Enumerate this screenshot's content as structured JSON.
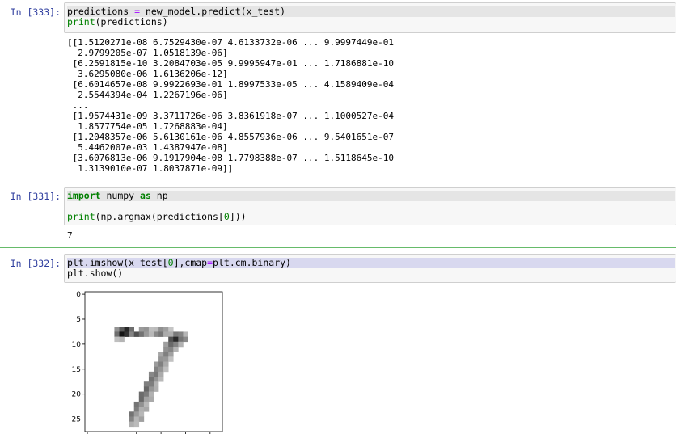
{
  "cells": [
    {
      "prompt": "In [333]:",
      "code_lines": [
        {
          "a": "predictions",
          "op": " = ",
          "b": "new_model.predict(x_test)"
        },
        {
          "fn": "print",
          "b": "(predictions)"
        }
      ],
      "output_lines": [
        "[[1.5120271e-08 6.7529430e-07 4.6133732e-06 ... 9.9997449e-01",
        "  2.9799205e-07 1.0518139e-06]",
        " [6.2591815e-10 3.2084703e-05 9.9995947e-01 ... 1.7186881e-10",
        "  3.6295080e-06 1.6136206e-12]",
        " [6.6014657e-08 9.9922693e-01 1.8997533e-05 ... 4.1589409e-04",
        "  2.5544394e-04 1.2267196e-06]",
        " ...",
        " [1.9574431e-09 3.3711726e-06 3.8361918e-07 ... 1.1000527e-04",
        "  1.8577754e-05 1.7268883e-04]",
        " [1.2048357e-06 5.6130161e-06 4.8557936e-06 ... 9.5401651e-07",
        "  5.4462007e-03 1.4387947e-08]",
        " [3.6076813e-06 9.1917904e-08 1.7798388e-07 ... 1.5118645e-10",
        "  1.3139010e-07 1.8037871e-09]]"
      ]
    },
    {
      "prompt": "In [331]:",
      "code_import": "import",
      "code_mod": " numpy ",
      "code_as": "as",
      "code_alias": " np",
      "code_print": "print",
      "code_rest_a": "(np.argmax(predictions[",
      "code_zero": "0",
      "code_rest_b": "]))",
      "output": "7"
    },
    {
      "prompt": "In [332]:",
      "line1_a": "plt.imshow(x_test[",
      "line1_zero": "0",
      "line1_b": "],cmap",
      "line1_eq": "=",
      "line1_c": "plt.cm.binary)",
      "line2": "plt.show()"
    }
  ],
  "plot": {
    "y_ticks": [
      "0",
      "5",
      "10",
      "15",
      "20",
      "25"
    ],
    "image_description_digit": "7"
  }
}
